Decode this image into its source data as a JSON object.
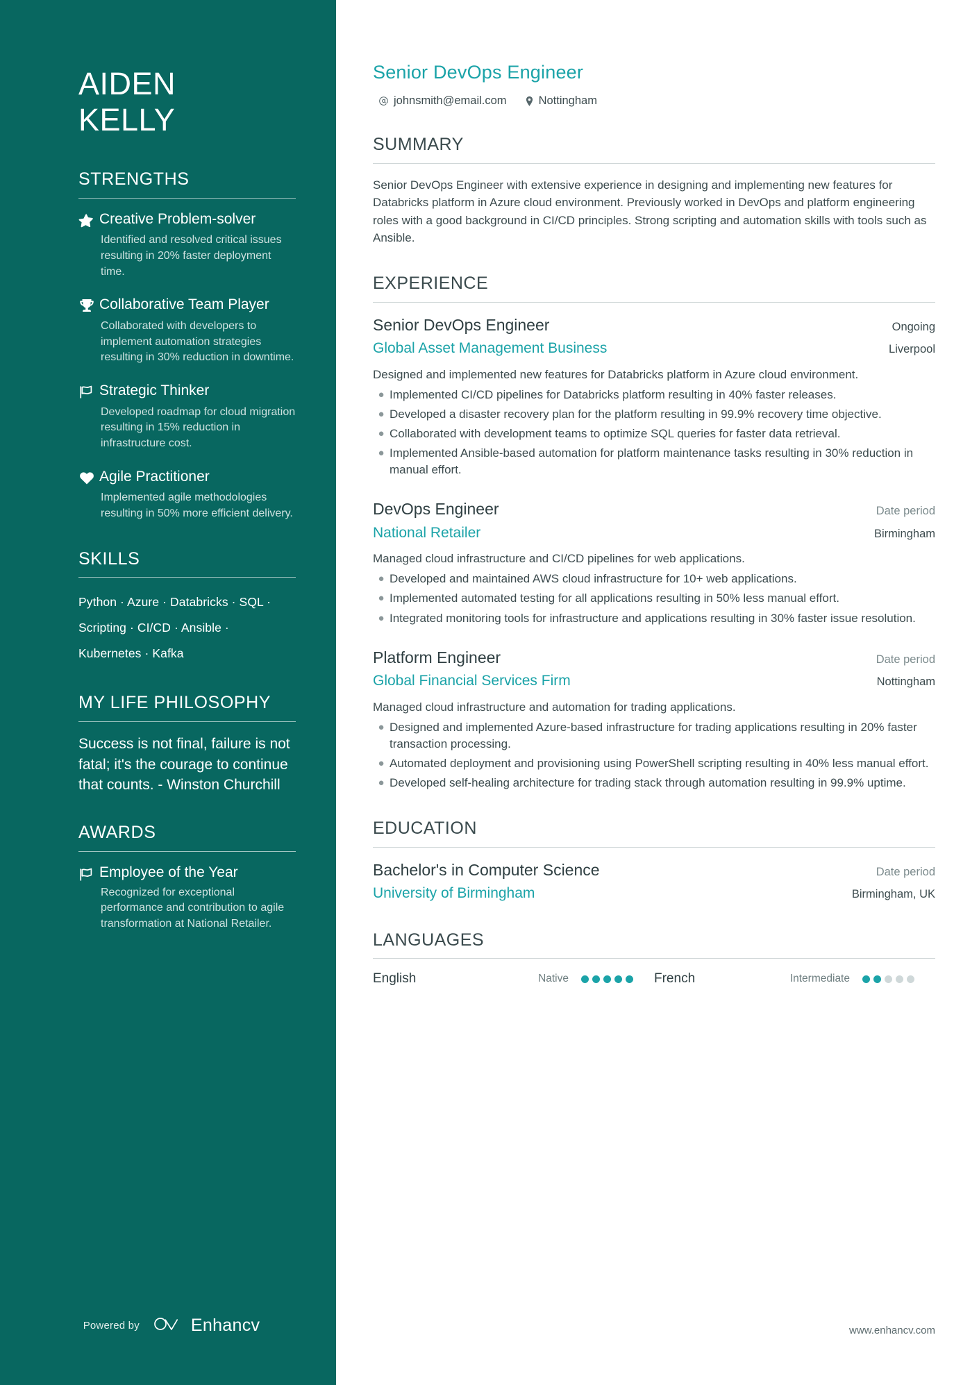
{
  "theme": {
    "sidebar_bg": "#086760",
    "accent": "#1ba3a8",
    "body_text": "#3d4c4f",
    "muted_text": "#7c8b8d"
  },
  "sidebar": {
    "name": "AIDEN\nKELLY",
    "strengths": {
      "heading": "STRENGTHS",
      "items": [
        {
          "icon": "star-icon",
          "title": "Creative Problem-solver",
          "desc": "Identified and resolved critical issues resulting in 20% faster deployment time."
        },
        {
          "icon": "trophy-icon",
          "title": "Collaborative Team Player",
          "desc": "Collaborated with developers to implement automation strategies resulting in 30% reduction in downtime."
        },
        {
          "icon": "flag-icon",
          "title": "Strategic Thinker",
          "desc": "Developed roadmap for cloud migration resulting in 15% reduction in infrastructure cost."
        },
        {
          "icon": "heart-icon",
          "title": "Agile Practitioner",
          "desc": "Implemented agile methodologies resulting in 50% more efficient delivery."
        }
      ]
    },
    "skills": {
      "heading": "SKILLS",
      "lines": [
        "Python · Azure · Databricks · SQL ·",
        "Scripting · CI/CD · Ansible ·",
        "Kubernetes · Kafka"
      ]
    },
    "philosophy": {
      "heading": "MY LIFE PHILOSOPHY",
      "quote": "Success is not final, failure is not fatal; it's the courage to continue that counts. - Winston Churchill"
    },
    "awards": {
      "heading": "AWARDS",
      "items": [
        {
          "icon": "flag-icon",
          "title": "Employee of the Year",
          "desc": "Recognized for exceptional performance and contribution to agile transformation at National Retailer."
        }
      ]
    },
    "footer": {
      "powered_by": "Powered by",
      "brand": "Enhancv",
      "logo_icon": "enhancv-infinity-icon"
    }
  },
  "main": {
    "job_title": "Senior DevOps Engineer",
    "contacts": [
      {
        "icon": "email-icon",
        "value": "johnsmith@email.com"
      },
      {
        "icon": "location-pin-icon",
        "value": "Nottingham"
      }
    ],
    "summary": {
      "heading": "SUMMARY",
      "text": "Senior DevOps Engineer with extensive experience in designing and implementing new features for Databricks platform in Azure cloud environment. Previously worked in DevOps and platform engineering roles with a good background in CI/CD principles. Strong scripting and automation skills with tools such as Ansible."
    },
    "experience": {
      "heading": "EXPERIENCE",
      "items": [
        {
          "role": "Senior DevOps Engineer",
          "date": "Ongoing",
          "date_dark": true,
          "company": "Global Asset Management Business",
          "location": "Liverpool",
          "lead": "Designed and implemented new features for Databricks platform in Azure cloud environment.",
          "bullets": [
            "Implemented CI/CD pipelines for Databricks platform resulting in 40% faster releases.",
            "Developed a disaster recovery plan for the platform resulting in 99.9% recovery time objective.",
            "Collaborated with development teams to optimize SQL queries for faster data retrieval.",
            "Implemented Ansible-based automation for platform maintenance tasks resulting in 30% reduction in manual effort."
          ]
        },
        {
          "role": "DevOps Engineer",
          "date": "Date period",
          "date_dark": false,
          "company": "National Retailer",
          "location": "Birmingham",
          "lead": "Managed cloud infrastructure and CI/CD pipelines for web applications.",
          "bullets": [
            "Developed and maintained AWS cloud infrastructure for 10+ web applications.",
            "Implemented automated testing for all applications resulting in 50% less manual effort.",
            "Integrated monitoring tools for infrastructure and applications resulting in 30% faster issue resolution."
          ]
        },
        {
          "role": "Platform Engineer",
          "date": "Date period",
          "date_dark": false,
          "company": "Global Financial Services Firm",
          "location": "Nottingham",
          "lead": "Managed cloud infrastructure and automation for trading applications.",
          "bullets": [
            "Designed and implemented Azure-based infrastructure for trading applications resulting in 20% faster transaction processing.",
            "Automated deployment and provisioning using PowerShell scripting resulting in 40% less manual effort.",
            "Developed self-healing architecture for trading stack through automation resulting in 99.9% uptime."
          ]
        }
      ]
    },
    "education": {
      "heading": "EDUCATION",
      "items": [
        {
          "degree": "Bachelor's in Computer Science",
          "date": "Date period",
          "school": "University of Birmingham",
          "location": "Birmingham, UK"
        }
      ]
    },
    "languages": {
      "heading": "LANGUAGES",
      "items": [
        {
          "name": "English",
          "level": "Native",
          "filled": 5,
          "total": 5
        },
        {
          "name": "French",
          "level": "Intermediate",
          "filled": 2,
          "total": 5
        }
      ]
    },
    "footer_url": "www.enhancv.com"
  }
}
